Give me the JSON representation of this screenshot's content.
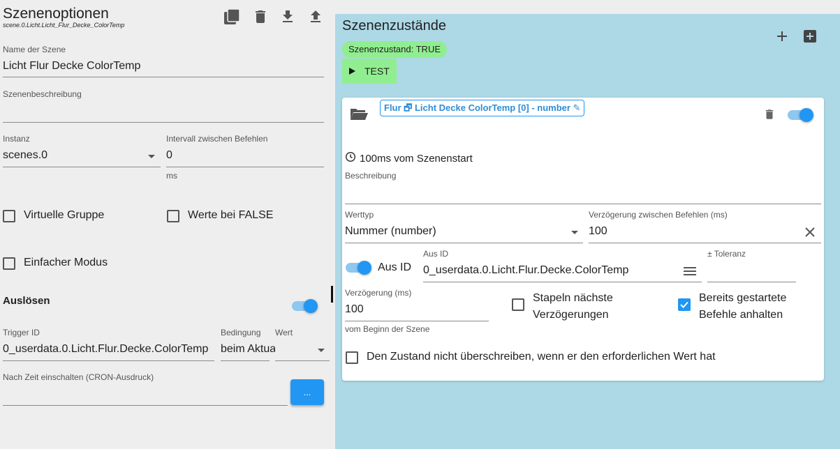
{
  "left": {
    "title": "Szenenoptionen",
    "subtitle": "scene.0.Licht.Licht_Flur_Decke_ColorTemp",
    "toolbar_icons": [
      "copy-icon",
      "delete-icon",
      "download-icon",
      "upload-icon"
    ],
    "name_label": "Name der Szene",
    "name_value": "Licht Flur Decke ColorTemp",
    "description_label": "Szenenbeschreibung",
    "description_value": "",
    "instance_label": "Instanz",
    "instance_value": "scenes.0",
    "interval_label": "Intervall zwischen Befehlen",
    "interval_value": "0",
    "interval_unit": "ms",
    "virtual_group_label": "Virtuelle Gruppe",
    "virtual_group_checked": false,
    "values_false_label": "Werte bei FALSE",
    "values_false_checked": false,
    "simple_mode_label": "Einfacher Modus",
    "simple_mode_checked": false,
    "trigger_heading": "Auslösen",
    "trigger_enabled": true,
    "trigger_id_label": "Trigger ID",
    "trigger_id_value": "0_userdata.0.Licht.Flur.Decke.ColorTemp",
    "condition_label": "Bedingung",
    "condition_value": "beim Aktualisieren",
    "value_label": "Wert",
    "value_value": "",
    "cron_label": "Nach Zeit einschalten (CRON-Ausdruck)",
    "cron_value": "",
    "cron_button": "..."
  },
  "right": {
    "title": "Szenenzustände",
    "state_chip": "Szenenzustand: TRUE",
    "test_button": "TEST",
    "card": {
      "id_chip": "Flur 🗗 Licht Decke ColorTemp [0] - number",
      "enabled": true,
      "delay_text": "100ms vom Szenenstart",
      "description_label": "Beschreibung",
      "description_value": "",
      "type_label": "Werttyp",
      "type_value": "Nummer (number)",
      "delay_between_label": "Verzögerung zwischen Befehlen (ms)",
      "delay_between_value": "100",
      "off_id_switch_label": "Aus ID",
      "off_id_enabled": true,
      "off_id_label": "Aus ID",
      "off_id_value": "0_userdata.0.Licht.Flur.Decke.ColorTemp",
      "tolerance_label": "± Toleranz",
      "tolerance_value": "",
      "delay_label": "Verzögerung (ms)",
      "delay_value": "100",
      "delay_helper": "vom Beginn der Szene",
      "stack_label_1": "Stapeln nächste",
      "stack_label_2": "Verzögerungen",
      "stack_checked": false,
      "stop_label_1": "Bereits gestartete",
      "stop_label_2": "Befehle anhalten",
      "stop_checked": true,
      "no_overwrite_label": "Den Zustand nicht überschreiben, wenn er den erforderlichen Wert hat",
      "no_overwrite_checked": false
    }
  },
  "colors": {
    "accent": "#2196f3",
    "right_panel_bg": "#add8e6",
    "chip_bg": "#90ee90",
    "page_bg": "#eeeeee"
  }
}
